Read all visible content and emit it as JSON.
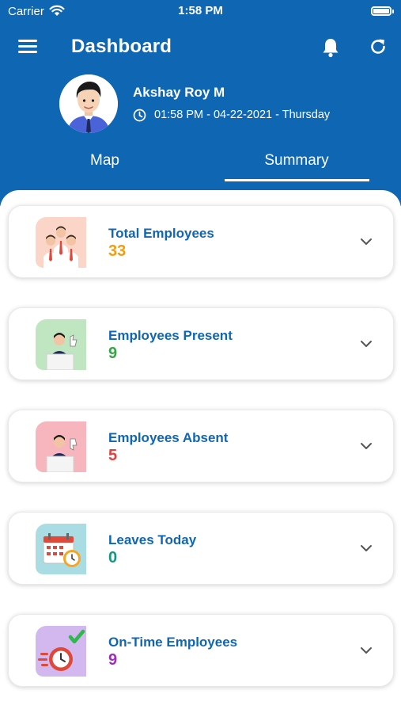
{
  "status_bar": {
    "carrier": "Carrier",
    "time": "1:58 PM"
  },
  "header": {
    "title": "Dashboard"
  },
  "user": {
    "name": "Akshay Roy M",
    "datetime": "01:58 PM - 04-22-2021 - Thursday"
  },
  "tabs": [
    {
      "label": "Map",
      "active": false
    },
    {
      "label": "Summary",
      "active": true
    }
  ],
  "cards": [
    {
      "title": "Total Employees",
      "value": "33",
      "value_color": "#f39c12",
      "icon": "team-icon"
    },
    {
      "title": "Employees Present",
      "value": "9",
      "value_color": "#3aa34a",
      "icon": "present-employee-icon"
    },
    {
      "title": "Employees Absent",
      "value": "5",
      "value_color": "#e04040",
      "icon": "absent-employee-icon"
    },
    {
      "title": "Leaves Today",
      "value": "0",
      "value_color": "#16967f",
      "icon": "calendar-leave-icon"
    },
    {
      "title": "On-Time Employees",
      "value": "9",
      "value_color": "#9b2fb8",
      "icon": "on-time-clock-icon"
    }
  ],
  "colors": {
    "header_bg": "#0f66b3",
    "card_title": "#0f66b3"
  }
}
